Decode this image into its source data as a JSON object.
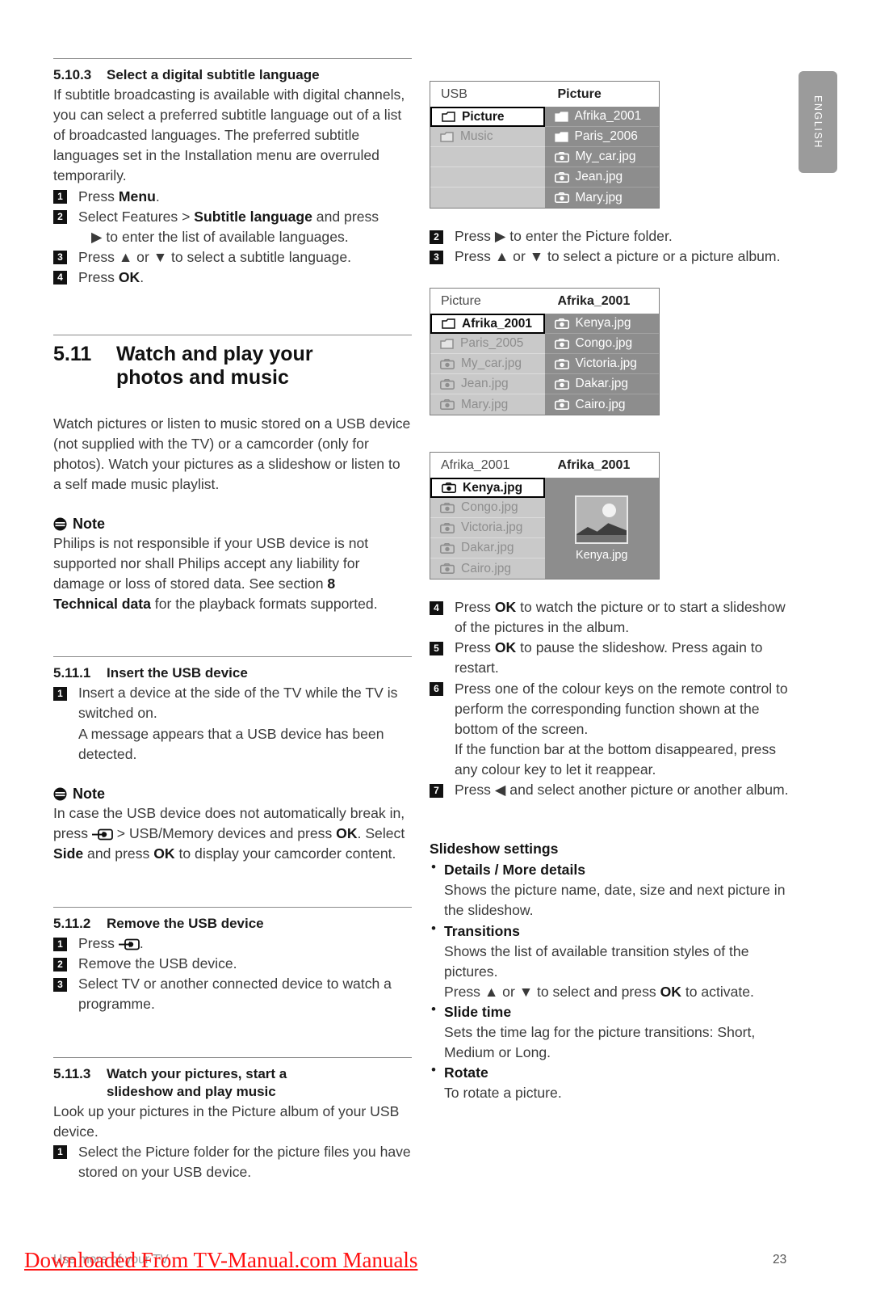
{
  "page": {
    "number": "23",
    "language_tab": "ENGLISH"
  },
  "left_column": {
    "s5103": {
      "number": "5.10.3",
      "title": "Select a digital subtitle language",
      "intro": "If subtitle broadcasting is available with digital channels, you can select a preferred subtitle language out of a list of broadcasted languages. The preferred subtitle languages set in the Installation menu are overruled temporarily.",
      "steps": [
        {
          "n": "1",
          "pre": "Press ",
          "bold": "Menu",
          "post": "."
        },
        {
          "n": "2",
          "pre": "Select Features > ",
          "bold": "Subtitle language",
          "post": " and press",
          "cont": "▶ to enter the list of available languages."
        },
        {
          "n": "3",
          "pre": "Press ▲ or ▼ to select a subtitle language.",
          "bold": "",
          "post": ""
        },
        {
          "n": "4",
          "pre": "Press ",
          "bold": "OK",
          "post": "."
        }
      ]
    },
    "s511": {
      "number": "5.11",
      "title_line1": "Watch and play your",
      "title_line2": "photos and music",
      "body": "Watch pictures or listen to music stored on a USB device (not supplied with the TV) or a camcorder (only for photos). Watch your pictures as a slideshow or listen to a self made music playlist.",
      "note_label": "Note",
      "note_a": "Philips is not responsible if your USB device is not supported nor shall Philips accept any liability for damage or loss of stored data. See section ",
      "note_a_bold1": "8",
      "note_a_mid": "",
      "note_a_bold2": "Technical data",
      "note_a_end": " for the playback formats supported."
    },
    "s5111": {
      "number": "5.11.1",
      "title": "Insert the USB device",
      "step1_n": "1",
      "step1": "Insert a device at the side of the TV while the TV is switched on.",
      "step1_cont": "A message appears that a USB device has been detected.",
      "note_label": "Note",
      "note_p1": "In case the USB device does not automatically break in, press ",
      "note_icon": "source-icon",
      "note_p2": " > USB/Memory devices and press ",
      "note_b1": "OK",
      "note_p3": ". Select ",
      "note_b2": "Side",
      "note_p4": " and press ",
      "note_b3": "OK",
      "note_p5": " to display your camcorder content."
    },
    "s5112": {
      "number": "5.11.2",
      "title": "Remove the USB device",
      "steps": [
        {
          "n": "1",
          "text_pre": "Press ",
          "icon": "source-icon",
          "text_post": "."
        },
        {
          "n": "2",
          "text_pre": "Remove the USB device.",
          "icon": "",
          "text_post": ""
        },
        {
          "n": "3",
          "text_pre": "Select TV or another connected device to watch a programme.",
          "icon": "",
          "text_post": ""
        }
      ]
    },
    "s5113": {
      "number": "5.11.3",
      "title_line1": "Watch your pictures, start a",
      "title_line2": "slideshow and play music",
      "body": "Look up your pictures in the Picture album of your USB device.",
      "step1_n": "1",
      "step1": "Select the Picture folder for the picture files you have stored on your USB device."
    }
  },
  "right_column": {
    "menu1": {
      "header_left": "USB",
      "header_right": "Picture",
      "left_items": [
        {
          "icon": "folder-icon",
          "label": "Picture",
          "selected": true
        },
        {
          "icon": "folder-icon",
          "label": "Music",
          "selected": false
        },
        {
          "icon": "",
          "label": "",
          "selected": false
        },
        {
          "icon": "",
          "label": "",
          "selected": false
        },
        {
          "icon": "",
          "label": "",
          "selected": false
        }
      ],
      "right_items": [
        {
          "icon": "folder-icon",
          "label": "Afrika_2001"
        },
        {
          "icon": "folder-icon",
          "label": "Paris_2006"
        },
        {
          "icon": "photo-icon",
          "label": "My_car.jpg"
        },
        {
          "icon": "photo-icon",
          "label": "Jean.jpg"
        },
        {
          "icon": "photo-icon",
          "label": "Mary.jpg"
        }
      ]
    },
    "steps_a": [
      {
        "n": "2",
        "text": "Press ▶ to enter the Picture folder."
      },
      {
        "n": "3",
        "text": "Press ▲ or ▼ to select a picture or a picture album."
      }
    ],
    "menu2": {
      "header_left": "Picture",
      "header_right": "Afrika_2001",
      "left_items": [
        {
          "icon": "folder-icon",
          "label": "Afrika_2001",
          "selected": true
        },
        {
          "icon": "folder-icon",
          "label": "Paris_2005",
          "selected": false
        },
        {
          "icon": "photo-icon",
          "label": "My_car.jpg",
          "selected": false
        },
        {
          "icon": "photo-icon",
          "label": "Jean.jpg",
          "selected": false
        },
        {
          "icon": "photo-icon",
          "label": "Mary.jpg",
          "selected": false
        }
      ],
      "right_items": [
        {
          "icon": "photo-icon",
          "label": "Kenya.jpg"
        },
        {
          "icon": "photo-icon",
          "label": "Congo.jpg"
        },
        {
          "icon": "photo-icon",
          "label": "Victoria.jpg"
        },
        {
          "icon": "photo-icon",
          "label": "Dakar.jpg"
        },
        {
          "icon": "photo-icon",
          "label": "Cairo.jpg"
        }
      ]
    },
    "menu3": {
      "header_left": "Afrika_2001",
      "header_right": "Afrika_2001",
      "left_items": [
        {
          "icon": "photo-icon",
          "label": "Kenya.jpg",
          "selected": true
        },
        {
          "icon": "photo-icon",
          "label": "Congo.jpg",
          "selected": false
        },
        {
          "icon": "photo-icon",
          "label": "Victoria.jpg",
          "selected": false
        },
        {
          "icon": "photo-icon",
          "label": "Dakar.jpg",
          "selected": false
        },
        {
          "icon": "photo-icon",
          "label": "Cairo.jpg",
          "selected": false
        }
      ],
      "preview_name": "Kenya.jpg"
    },
    "steps_b": [
      {
        "n": "4",
        "pre": "Press ",
        "bold": "OK",
        "post": " to watch the picture or to start a slideshow of the pictures in the album."
      },
      {
        "n": "5",
        "pre": "Press ",
        "bold": "OK",
        "post": " to pause the slideshow. Press again to restart."
      },
      {
        "n": "6",
        "pre": "Press one of the colour keys on the remote control to perform the corresponding function shown at the bottom of the screen.",
        "bold": "",
        "post": "",
        "cont": "If the function bar at the bottom disappeared, press any colour key to let it reappear."
      },
      {
        "n": "7",
        "pre": "Press ◀ and select another picture or another album.",
        "bold": "",
        "post": ""
      }
    ],
    "slideshow": {
      "heading": "Slideshow settings",
      "items": [
        {
          "title": "Details / More details",
          "desc": "Shows the picture name, date, size and next picture in the slideshow."
        },
        {
          "title": "Transitions",
          "desc": "Shows the list of available transition styles of the pictures.",
          "desc2_pre": "Press ▲ or ▼ to select and press ",
          "desc2_bold": "OK",
          "desc2_post": " to activate."
        },
        {
          "title": "Slide time",
          "desc": "Sets the time lag for the picture transitions: Short, Medium or Long."
        },
        {
          "title": "Rotate",
          "desc": "To rotate a picture."
        }
      ]
    }
  },
  "footer": {
    "gray_text": "Use more of your TV",
    "watermark": "Downloaded From TV-Manual.com Manuals",
    "page": "23"
  }
}
